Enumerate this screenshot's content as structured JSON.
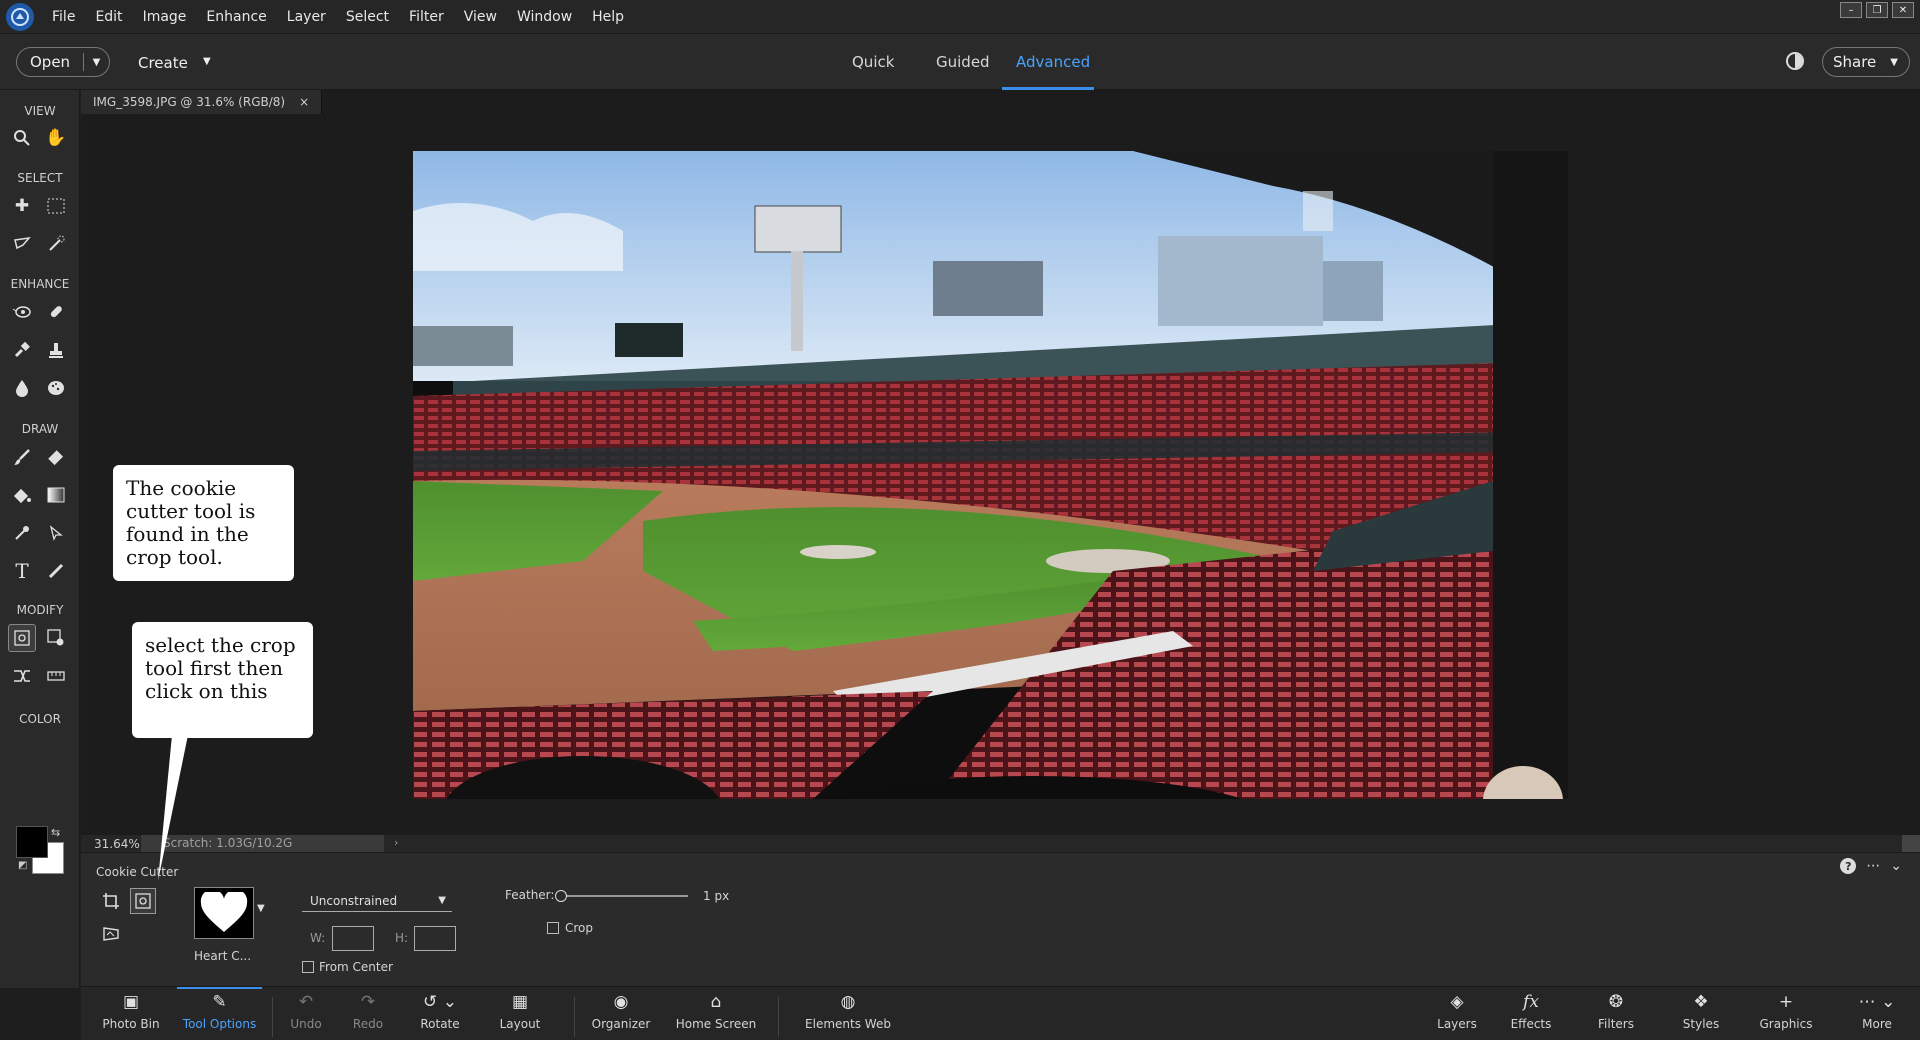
{
  "menubar": {
    "items": [
      "File",
      "Edit",
      "Image",
      "Enhance",
      "Layer",
      "Select",
      "Filter",
      "View",
      "Window",
      "Help"
    ],
    "window_controls": [
      "–",
      "❐",
      "✕"
    ]
  },
  "topbar": {
    "open_label": "Open",
    "create_label": "Create",
    "modes": [
      "Quick",
      "Guided",
      "Advanced"
    ],
    "active_mode": "Advanced",
    "share_label": "Share"
  },
  "toolbar": {
    "sections": {
      "view": "VIEW",
      "select": "SELECT",
      "enhance": "ENHANCE",
      "draw": "DRAW",
      "modify": "MODIFY",
      "color": "COLOR"
    },
    "tools": {
      "zoom": "zoom-icon",
      "hand": "hand-icon",
      "move": "move-icon",
      "marquee": "marquee-icon",
      "lasso": "lasso-icon",
      "quick-select": "quick-select-icon",
      "red-eye": "red-eye-icon",
      "spot-heal": "spot-healing-icon",
      "smart-brush": "smart-brush-icon",
      "clone-stamp": "clone-stamp-icon",
      "blur": "blur-icon",
      "sponge": "sponge-icon",
      "brush": "brush-icon",
      "eraser": "eraser-icon",
      "paint-bucket": "paint-bucket-icon",
      "gradient": "gradient-icon",
      "eyedropper": "eyedropper-icon",
      "custom-shape": "custom-shape-icon",
      "type": "type-icon",
      "pencil": "pencil-icon",
      "crop": "crop-icon",
      "recompose": "recompose-icon",
      "content-move": "content-aware-move-icon",
      "straighten": "straighten-icon"
    },
    "colors": {
      "foreground": "#000000",
      "background": "#ffffff"
    }
  },
  "document": {
    "tab_label": "IMG_3598.JPG @ 31.6% (RGB/8)",
    "close_glyph": "×"
  },
  "status": {
    "zoom": "31.64%",
    "scratch": "Scratch: 1.03G/10.2G"
  },
  "tool_options": {
    "title": "Cookie Cutter",
    "shape_label": "Heart C...",
    "aspect": "Unconstrained",
    "w_label": "W:",
    "h_label": "H:",
    "from_center_label": "From Center",
    "feather_label": "Feather:",
    "feather_value": "1 px",
    "feather_fraction": 0.0,
    "crop_label": "Crop"
  },
  "taskbar": {
    "items": [
      {
        "label": "Photo Bin",
        "icon": "photo-bin-icon"
      },
      {
        "label": "Tool Options",
        "icon": "tool-options-icon"
      },
      {
        "label": "Undo",
        "icon": "undo-icon"
      },
      {
        "label": "Redo",
        "icon": "redo-icon"
      },
      {
        "label": "Rotate",
        "icon": "rotate-icon"
      },
      {
        "label": "Layout",
        "icon": "layout-icon"
      },
      {
        "label": "Organizer",
        "icon": "organizer-icon"
      },
      {
        "label": "Home Screen",
        "icon": "home-icon"
      },
      {
        "label": "Elements Web",
        "icon": "globe-icon"
      },
      {
        "label": "Layers",
        "icon": "layers-icon"
      },
      {
        "label": "Effects",
        "icon": "effects-icon"
      },
      {
        "label": "Filters",
        "icon": "filters-icon"
      },
      {
        "label": "Styles",
        "icon": "styles-icon"
      },
      {
        "label": "Graphics",
        "icon": "graphics-icon"
      },
      {
        "label": "More",
        "icon": "more-icon"
      }
    ]
  },
  "callouts": {
    "first": "The cookie cutter tool is found in the crop tool.",
    "second": "select the crop tool first then click on this"
  },
  "accent_color": "#4aa3ff"
}
